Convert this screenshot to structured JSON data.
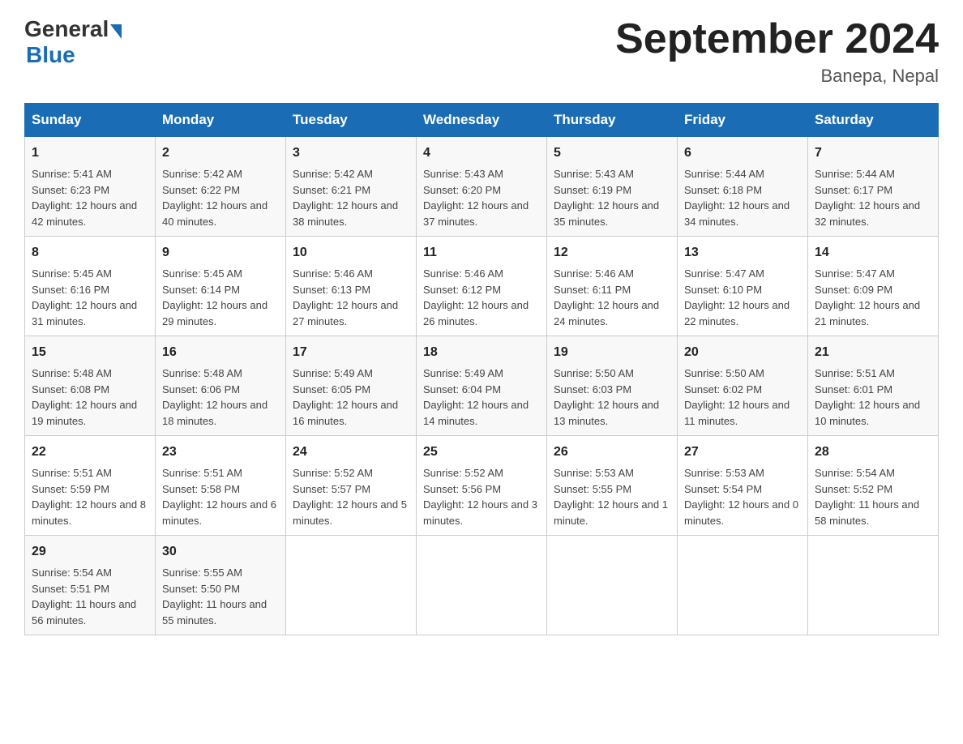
{
  "header": {
    "logo_general": "General",
    "logo_blue": "Blue",
    "title": "September 2024",
    "location": "Banepa, Nepal"
  },
  "calendar": {
    "weekdays": [
      "Sunday",
      "Monday",
      "Tuesday",
      "Wednesday",
      "Thursday",
      "Friday",
      "Saturday"
    ],
    "weeks": [
      [
        {
          "day": "1",
          "sunrise": "5:41 AM",
          "sunset": "6:23 PM",
          "daylight": "12 hours and 42 minutes."
        },
        {
          "day": "2",
          "sunrise": "5:42 AM",
          "sunset": "6:22 PM",
          "daylight": "12 hours and 40 minutes."
        },
        {
          "day": "3",
          "sunrise": "5:42 AM",
          "sunset": "6:21 PM",
          "daylight": "12 hours and 38 minutes."
        },
        {
          "day": "4",
          "sunrise": "5:43 AM",
          "sunset": "6:20 PM",
          "daylight": "12 hours and 37 minutes."
        },
        {
          "day": "5",
          "sunrise": "5:43 AM",
          "sunset": "6:19 PM",
          "daylight": "12 hours and 35 minutes."
        },
        {
          "day": "6",
          "sunrise": "5:44 AM",
          "sunset": "6:18 PM",
          "daylight": "12 hours and 34 minutes."
        },
        {
          "day": "7",
          "sunrise": "5:44 AM",
          "sunset": "6:17 PM",
          "daylight": "12 hours and 32 minutes."
        }
      ],
      [
        {
          "day": "8",
          "sunrise": "5:45 AM",
          "sunset": "6:16 PM",
          "daylight": "12 hours and 31 minutes."
        },
        {
          "day": "9",
          "sunrise": "5:45 AM",
          "sunset": "6:14 PM",
          "daylight": "12 hours and 29 minutes."
        },
        {
          "day": "10",
          "sunrise": "5:46 AM",
          "sunset": "6:13 PM",
          "daylight": "12 hours and 27 minutes."
        },
        {
          "day": "11",
          "sunrise": "5:46 AM",
          "sunset": "6:12 PM",
          "daylight": "12 hours and 26 minutes."
        },
        {
          "day": "12",
          "sunrise": "5:46 AM",
          "sunset": "6:11 PM",
          "daylight": "12 hours and 24 minutes."
        },
        {
          "day": "13",
          "sunrise": "5:47 AM",
          "sunset": "6:10 PM",
          "daylight": "12 hours and 22 minutes."
        },
        {
          "day": "14",
          "sunrise": "5:47 AM",
          "sunset": "6:09 PM",
          "daylight": "12 hours and 21 minutes."
        }
      ],
      [
        {
          "day": "15",
          "sunrise": "5:48 AM",
          "sunset": "6:08 PM",
          "daylight": "12 hours and 19 minutes."
        },
        {
          "day": "16",
          "sunrise": "5:48 AM",
          "sunset": "6:06 PM",
          "daylight": "12 hours and 18 minutes."
        },
        {
          "day": "17",
          "sunrise": "5:49 AM",
          "sunset": "6:05 PM",
          "daylight": "12 hours and 16 minutes."
        },
        {
          "day": "18",
          "sunrise": "5:49 AM",
          "sunset": "6:04 PM",
          "daylight": "12 hours and 14 minutes."
        },
        {
          "day": "19",
          "sunrise": "5:50 AM",
          "sunset": "6:03 PM",
          "daylight": "12 hours and 13 minutes."
        },
        {
          "day": "20",
          "sunrise": "5:50 AM",
          "sunset": "6:02 PM",
          "daylight": "12 hours and 11 minutes."
        },
        {
          "day": "21",
          "sunrise": "5:51 AM",
          "sunset": "6:01 PM",
          "daylight": "12 hours and 10 minutes."
        }
      ],
      [
        {
          "day": "22",
          "sunrise": "5:51 AM",
          "sunset": "5:59 PM",
          "daylight": "12 hours and 8 minutes."
        },
        {
          "day": "23",
          "sunrise": "5:51 AM",
          "sunset": "5:58 PM",
          "daylight": "12 hours and 6 minutes."
        },
        {
          "day": "24",
          "sunrise": "5:52 AM",
          "sunset": "5:57 PM",
          "daylight": "12 hours and 5 minutes."
        },
        {
          "day": "25",
          "sunrise": "5:52 AM",
          "sunset": "5:56 PM",
          "daylight": "12 hours and 3 minutes."
        },
        {
          "day": "26",
          "sunrise": "5:53 AM",
          "sunset": "5:55 PM",
          "daylight": "12 hours and 1 minute."
        },
        {
          "day": "27",
          "sunrise": "5:53 AM",
          "sunset": "5:54 PM",
          "daylight": "12 hours and 0 minutes."
        },
        {
          "day": "28",
          "sunrise": "5:54 AM",
          "sunset": "5:52 PM",
          "daylight": "11 hours and 58 minutes."
        }
      ],
      [
        {
          "day": "29",
          "sunrise": "5:54 AM",
          "sunset": "5:51 PM",
          "daylight": "11 hours and 56 minutes."
        },
        {
          "day": "30",
          "sunrise": "5:55 AM",
          "sunset": "5:50 PM",
          "daylight": "11 hours and 55 minutes."
        },
        null,
        null,
        null,
        null,
        null
      ]
    ]
  }
}
